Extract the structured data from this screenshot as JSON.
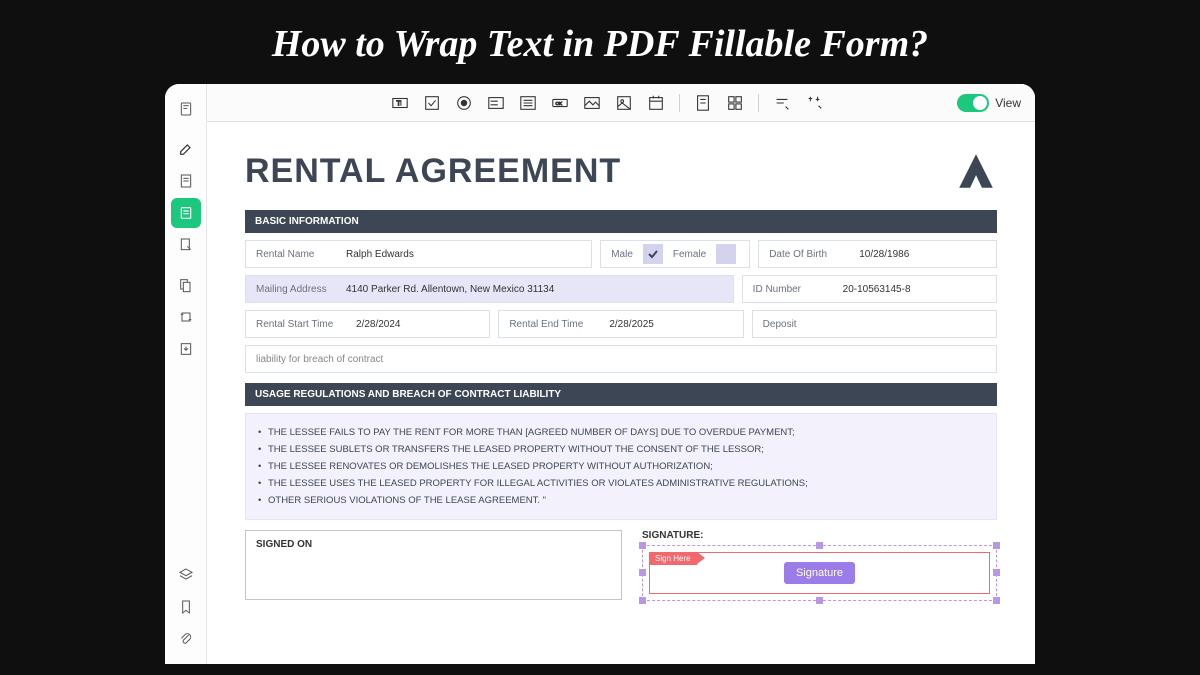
{
  "page_title": "How to Wrap Text in PDF Fillable Form?",
  "toolbar": {
    "view_label": "View"
  },
  "doc": {
    "title": "RENTAL AGREEMENT",
    "section1": "BASIC INFORMATION",
    "fields": {
      "rental_name_label": "Rental Name",
      "rental_name_value": "Ralph Edwards",
      "male": "Male",
      "female": "Female",
      "dob_label": "Date Of Birth",
      "dob_value": "10/28/1986",
      "mailing_label": "Mailing Address",
      "mailing_value": "4140 Parker Rd. Allentown, New Mexico 31134",
      "id_label": "ID Number",
      "id_value": "20-10563145-8",
      "start_label": "Rental Start Time",
      "start_value": "2/28/2024",
      "end_label": "Rental End Time",
      "end_value": "2/28/2025",
      "deposit_label": "Deposit",
      "liability": "liability for breach of contract"
    },
    "section2": "USAGE REGULATIONS AND BREACH OF CONTRACT LIABILITY",
    "terms": [
      "THE LESSEE FAILS TO PAY THE RENT FOR MORE THAN [AGREED NUMBER OF DAYS] DUE TO OVERDUE PAYMENT;",
      "THE LESSEE SUBLETS OR TRANSFERS THE LEASED PROPERTY WITHOUT THE CONSENT OF THE LESSOR;",
      "THE LESSEE RENOVATES OR DEMOLISHES THE LEASED PROPERTY WITHOUT AUTHORIZATION;",
      "THE LESSEE USES THE LEASED PROPERTY FOR ILLEGAL ACTIVITIES OR VIOLATES ADMINISTRATIVE REGULATIONS;",
      "OTHER SERIOUS VIOLATIONS OF THE LEASE AGREEMENT. \""
    ],
    "signed_on": "SIGNED ON",
    "signature_label": "SIGNATURE:",
    "sign_here": "Sign Here",
    "signature_btn": "Signature"
  }
}
